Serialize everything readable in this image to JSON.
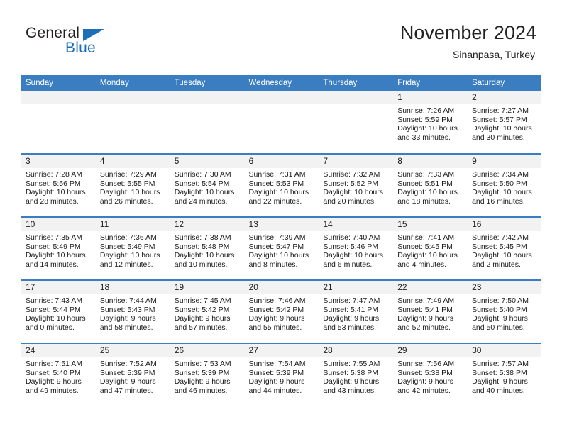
{
  "brand": {
    "word_one": "General",
    "word_two": "Blue",
    "accent_color": "#1d70b8"
  },
  "header": {
    "title": "November 2024",
    "subtitle": "Sinanpasa, Turkey"
  },
  "calendar": {
    "header_bg": "#3a7dc0",
    "daynum_bg": "#f2f2f2",
    "weekdays": [
      "Sunday",
      "Monday",
      "Tuesday",
      "Wednesday",
      "Thursday",
      "Friday",
      "Saturday"
    ],
    "weeks": [
      [
        {
          "day": "",
          "sunrise": "",
          "sunset": "",
          "daylight": ""
        },
        {
          "day": "",
          "sunrise": "",
          "sunset": "",
          "daylight": ""
        },
        {
          "day": "",
          "sunrise": "",
          "sunset": "",
          "daylight": ""
        },
        {
          "day": "",
          "sunrise": "",
          "sunset": "",
          "daylight": ""
        },
        {
          "day": "",
          "sunrise": "",
          "sunset": "",
          "daylight": ""
        },
        {
          "day": "1",
          "sunrise": "Sunrise: 7:26 AM",
          "sunset": "Sunset: 5:59 PM",
          "daylight": "Daylight: 10 hours and 33 minutes."
        },
        {
          "day": "2",
          "sunrise": "Sunrise: 7:27 AM",
          "sunset": "Sunset: 5:57 PM",
          "daylight": "Daylight: 10 hours and 30 minutes."
        }
      ],
      [
        {
          "day": "3",
          "sunrise": "Sunrise: 7:28 AM",
          "sunset": "Sunset: 5:56 PM",
          "daylight": "Daylight: 10 hours and 28 minutes."
        },
        {
          "day": "4",
          "sunrise": "Sunrise: 7:29 AM",
          "sunset": "Sunset: 5:55 PM",
          "daylight": "Daylight: 10 hours and 26 minutes."
        },
        {
          "day": "5",
          "sunrise": "Sunrise: 7:30 AM",
          "sunset": "Sunset: 5:54 PM",
          "daylight": "Daylight: 10 hours and 24 minutes."
        },
        {
          "day": "6",
          "sunrise": "Sunrise: 7:31 AM",
          "sunset": "Sunset: 5:53 PM",
          "daylight": "Daylight: 10 hours and 22 minutes."
        },
        {
          "day": "7",
          "sunrise": "Sunrise: 7:32 AM",
          "sunset": "Sunset: 5:52 PM",
          "daylight": "Daylight: 10 hours and 20 minutes."
        },
        {
          "day": "8",
          "sunrise": "Sunrise: 7:33 AM",
          "sunset": "Sunset: 5:51 PM",
          "daylight": "Daylight: 10 hours and 18 minutes."
        },
        {
          "day": "9",
          "sunrise": "Sunrise: 7:34 AM",
          "sunset": "Sunset: 5:50 PM",
          "daylight": "Daylight: 10 hours and 16 minutes."
        }
      ],
      [
        {
          "day": "10",
          "sunrise": "Sunrise: 7:35 AM",
          "sunset": "Sunset: 5:49 PM",
          "daylight": "Daylight: 10 hours and 14 minutes."
        },
        {
          "day": "11",
          "sunrise": "Sunrise: 7:36 AM",
          "sunset": "Sunset: 5:49 PM",
          "daylight": "Daylight: 10 hours and 12 minutes."
        },
        {
          "day": "12",
          "sunrise": "Sunrise: 7:38 AM",
          "sunset": "Sunset: 5:48 PM",
          "daylight": "Daylight: 10 hours and 10 minutes."
        },
        {
          "day": "13",
          "sunrise": "Sunrise: 7:39 AM",
          "sunset": "Sunset: 5:47 PM",
          "daylight": "Daylight: 10 hours and 8 minutes."
        },
        {
          "day": "14",
          "sunrise": "Sunrise: 7:40 AM",
          "sunset": "Sunset: 5:46 PM",
          "daylight": "Daylight: 10 hours and 6 minutes."
        },
        {
          "day": "15",
          "sunrise": "Sunrise: 7:41 AM",
          "sunset": "Sunset: 5:45 PM",
          "daylight": "Daylight: 10 hours and 4 minutes."
        },
        {
          "day": "16",
          "sunrise": "Sunrise: 7:42 AM",
          "sunset": "Sunset: 5:45 PM",
          "daylight": "Daylight: 10 hours and 2 minutes."
        }
      ],
      [
        {
          "day": "17",
          "sunrise": "Sunrise: 7:43 AM",
          "sunset": "Sunset: 5:44 PM",
          "daylight": "Daylight: 10 hours and 0 minutes."
        },
        {
          "day": "18",
          "sunrise": "Sunrise: 7:44 AM",
          "sunset": "Sunset: 5:43 PM",
          "daylight": "Daylight: 9 hours and 58 minutes."
        },
        {
          "day": "19",
          "sunrise": "Sunrise: 7:45 AM",
          "sunset": "Sunset: 5:42 PM",
          "daylight": "Daylight: 9 hours and 57 minutes."
        },
        {
          "day": "20",
          "sunrise": "Sunrise: 7:46 AM",
          "sunset": "Sunset: 5:42 PM",
          "daylight": "Daylight: 9 hours and 55 minutes."
        },
        {
          "day": "21",
          "sunrise": "Sunrise: 7:47 AM",
          "sunset": "Sunset: 5:41 PM",
          "daylight": "Daylight: 9 hours and 53 minutes."
        },
        {
          "day": "22",
          "sunrise": "Sunrise: 7:49 AM",
          "sunset": "Sunset: 5:41 PM",
          "daylight": "Daylight: 9 hours and 52 minutes."
        },
        {
          "day": "23",
          "sunrise": "Sunrise: 7:50 AM",
          "sunset": "Sunset: 5:40 PM",
          "daylight": "Daylight: 9 hours and 50 minutes."
        }
      ],
      [
        {
          "day": "24",
          "sunrise": "Sunrise: 7:51 AM",
          "sunset": "Sunset: 5:40 PM",
          "daylight": "Daylight: 9 hours and 49 minutes."
        },
        {
          "day": "25",
          "sunrise": "Sunrise: 7:52 AM",
          "sunset": "Sunset: 5:39 PM",
          "daylight": "Daylight: 9 hours and 47 minutes."
        },
        {
          "day": "26",
          "sunrise": "Sunrise: 7:53 AM",
          "sunset": "Sunset: 5:39 PM",
          "daylight": "Daylight: 9 hours and 46 minutes."
        },
        {
          "day": "27",
          "sunrise": "Sunrise: 7:54 AM",
          "sunset": "Sunset: 5:39 PM",
          "daylight": "Daylight: 9 hours and 44 minutes."
        },
        {
          "day": "28",
          "sunrise": "Sunrise: 7:55 AM",
          "sunset": "Sunset: 5:38 PM",
          "daylight": "Daylight: 9 hours and 43 minutes."
        },
        {
          "day": "29",
          "sunrise": "Sunrise: 7:56 AM",
          "sunset": "Sunset: 5:38 PM",
          "daylight": "Daylight: 9 hours and 42 minutes."
        },
        {
          "day": "30",
          "sunrise": "Sunrise: 7:57 AM",
          "sunset": "Sunset: 5:38 PM",
          "daylight": "Daylight: 9 hours and 40 minutes."
        }
      ]
    ]
  }
}
